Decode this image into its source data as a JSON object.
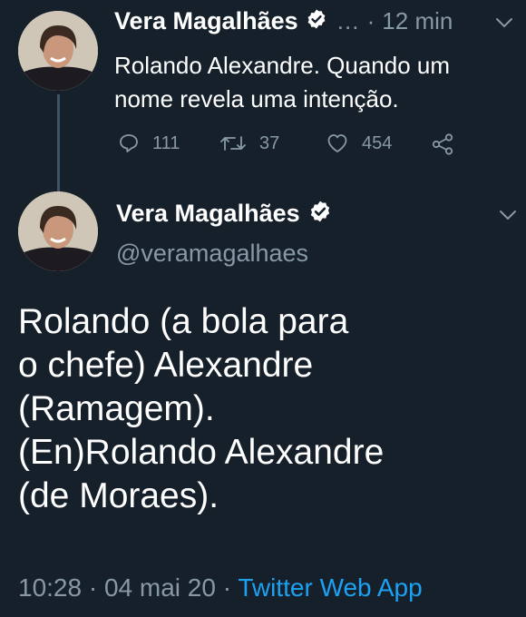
{
  "thread": {
    "reply_tweet": {
      "author_name": "Vera Magalhães",
      "truncation": "…",
      "time_sep": "·",
      "time_ago": "12 min",
      "text": "Rolando Alexandre. Quando um nome revela uma intenção.",
      "replies": "111",
      "retweets": "37",
      "likes": "454"
    },
    "main_tweet": {
      "author_name": "Vera Magalhães",
      "handle": "@veramagalhaes",
      "text": "Rolando (a bola para\no chefe) Alexandre\n(Ramagem).\n(En)Rolando Alexandre\n(de Moraes).",
      "time": "10:28",
      "sep1": "·",
      "date": "04 mai 20",
      "sep2": "·",
      "source": "Twitter Web App"
    }
  },
  "colors": {
    "background": "#15202b",
    "text": "#ffffff",
    "muted": "#8899a6",
    "link": "#1da1f2",
    "thread_line": "#3d5466"
  },
  "icons": [
    "verified-badge-icon",
    "chevron-down-icon",
    "reply-icon",
    "retweet-icon",
    "like-icon",
    "share-icon"
  ]
}
